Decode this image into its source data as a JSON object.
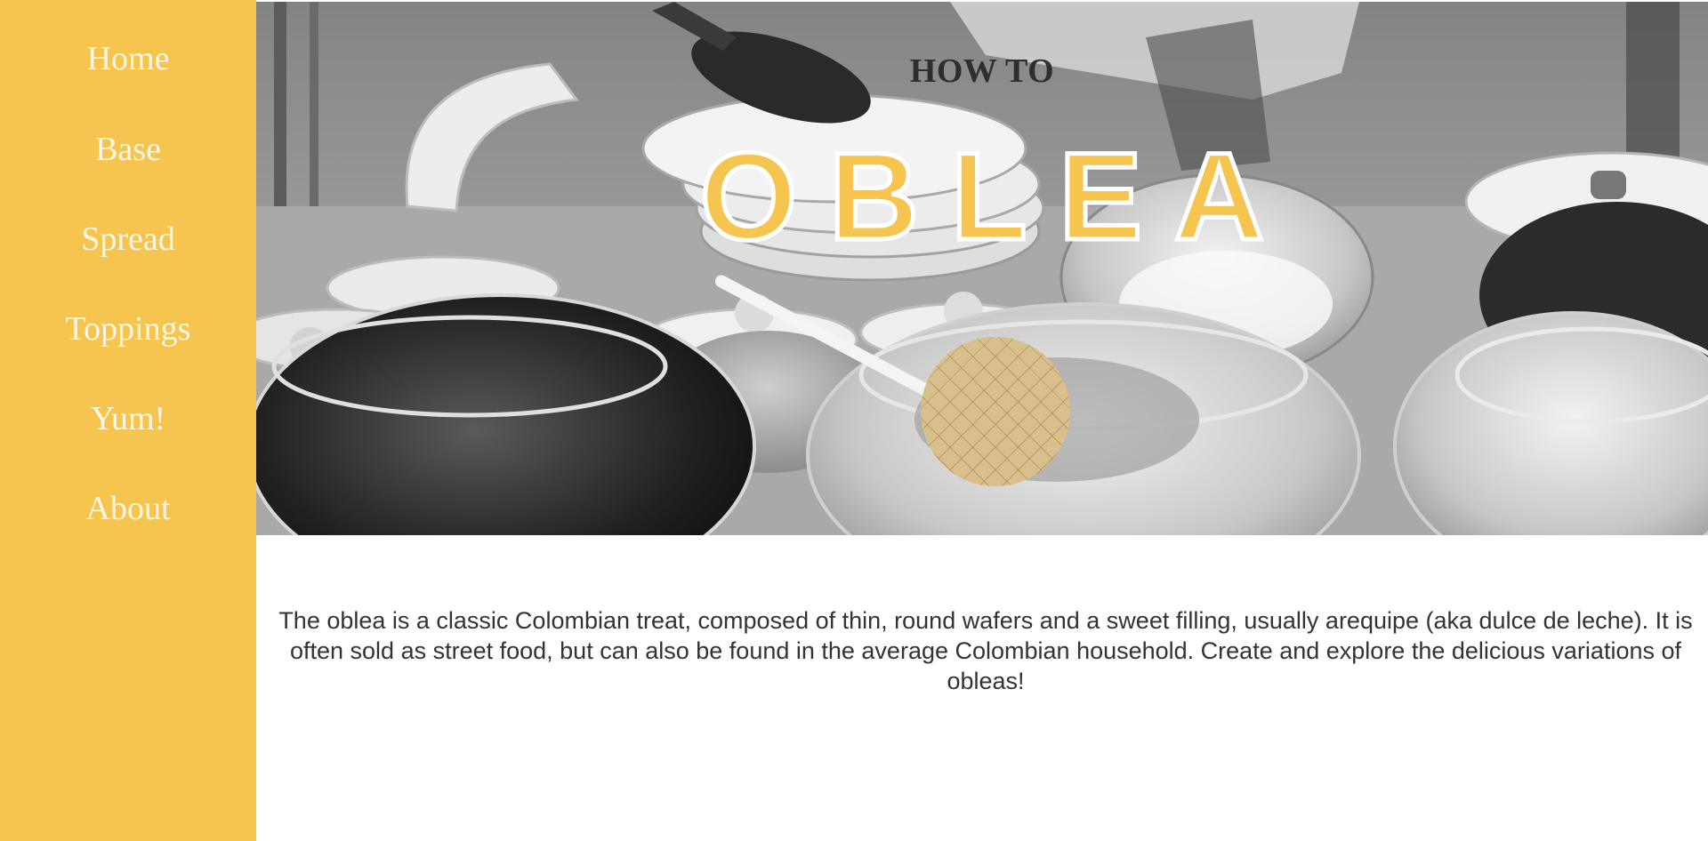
{
  "nav": {
    "items": [
      {
        "label": "Home"
      },
      {
        "label": "Base"
      },
      {
        "label": "Spread"
      },
      {
        "label": "Toppings"
      },
      {
        "label": "Yum!"
      },
      {
        "label": "About"
      }
    ]
  },
  "hero": {
    "kicker": "HOW TO",
    "title": "OBLEA",
    "image": "black-and-white photo of oblea wafers and jars of fillings",
    "wafer_icon": "wafer-icon"
  },
  "main": {
    "intro": "The oblea is a classic Colombian treat, composed of thin, round wafers and a sweet filling, usually arequipe (aka dulce de leche). It is often sold as street food, but can also be found in the average Colombian household. Create and explore the delicious variations of obleas!"
  },
  "colors": {
    "accent": "#f6c550",
    "nav_text": "#fff6e4",
    "heading_text": "#2e2e2e",
    "body_text": "#333333",
    "wafer": "#d8bf8c"
  }
}
